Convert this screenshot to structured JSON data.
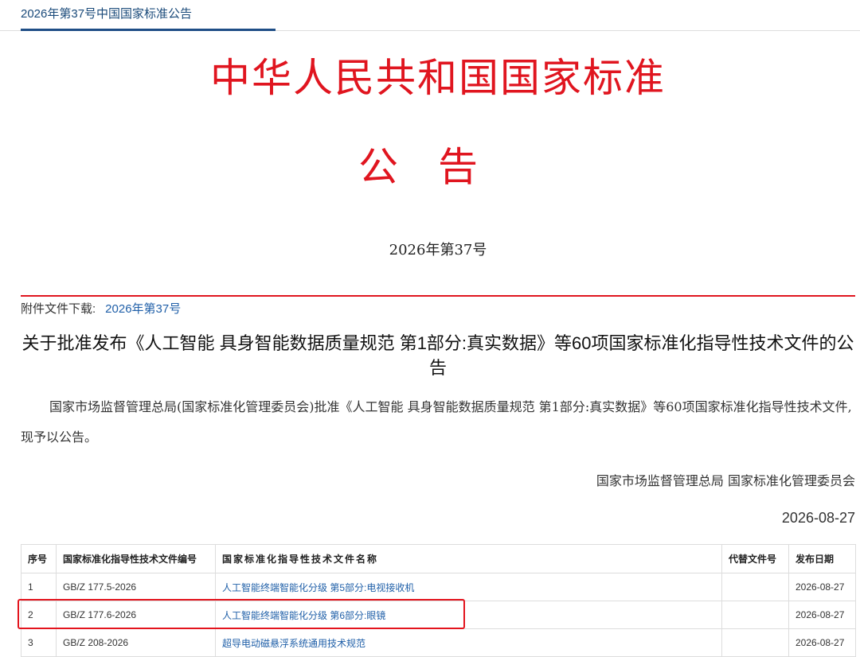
{
  "header": {
    "tab_title": "2026年第37号中国国家标准公告"
  },
  "announcement": {
    "main_title": "中华人民共和国国家标准",
    "sub_title": "公告",
    "issue_number": "2026年第37号",
    "attachment_label": "附件文件下载:",
    "attachment_link": "2026年第37号",
    "document_title": "关于批准发布《人工智能 具身智能数据质量规范 第1部分:真实数据》等60项国家标准化指导性技术文件的公告",
    "body_text": "国家市场监督管理总局(国家标准化管理委员会)批准《人工智能 具身智能数据质量规范 第1部分:真实数据》等60项国家标准化指导性技术文件,现予以公告。",
    "issuer": "国家市场监督管理总局 国家标准化管理委员会",
    "date": "2026-08-27"
  },
  "table": {
    "headers": {
      "seq": "序号",
      "code": "国家标准化指导性技术文件编号",
      "name": "国家标准化指导性技术文件名称",
      "replaces": "代替文件号",
      "pub_date": "发布日期"
    },
    "rows": [
      {
        "seq": "1",
        "code": "GB/Z 177.5-2026",
        "name": "人工智能终端智能化分级 第5部分:电视接收机",
        "replaces": "",
        "pub_date": "2026-08-27"
      },
      {
        "seq": "2",
        "code": "GB/Z 177.6-2026",
        "name": "人工智能终端智能化分级 第6部分:眼镜",
        "replaces": "",
        "pub_date": "2026-08-27"
      },
      {
        "seq": "3",
        "code": "GB/Z 208-2026",
        "name": "超导电动磁悬浮系统通用技术规范",
        "replaces": "",
        "pub_date": "2026-08-27"
      }
    ]
  },
  "colors": {
    "title_red": "#e0151f",
    "link_blue": "#1f5fa8",
    "highlight": "#e3141d"
  }
}
